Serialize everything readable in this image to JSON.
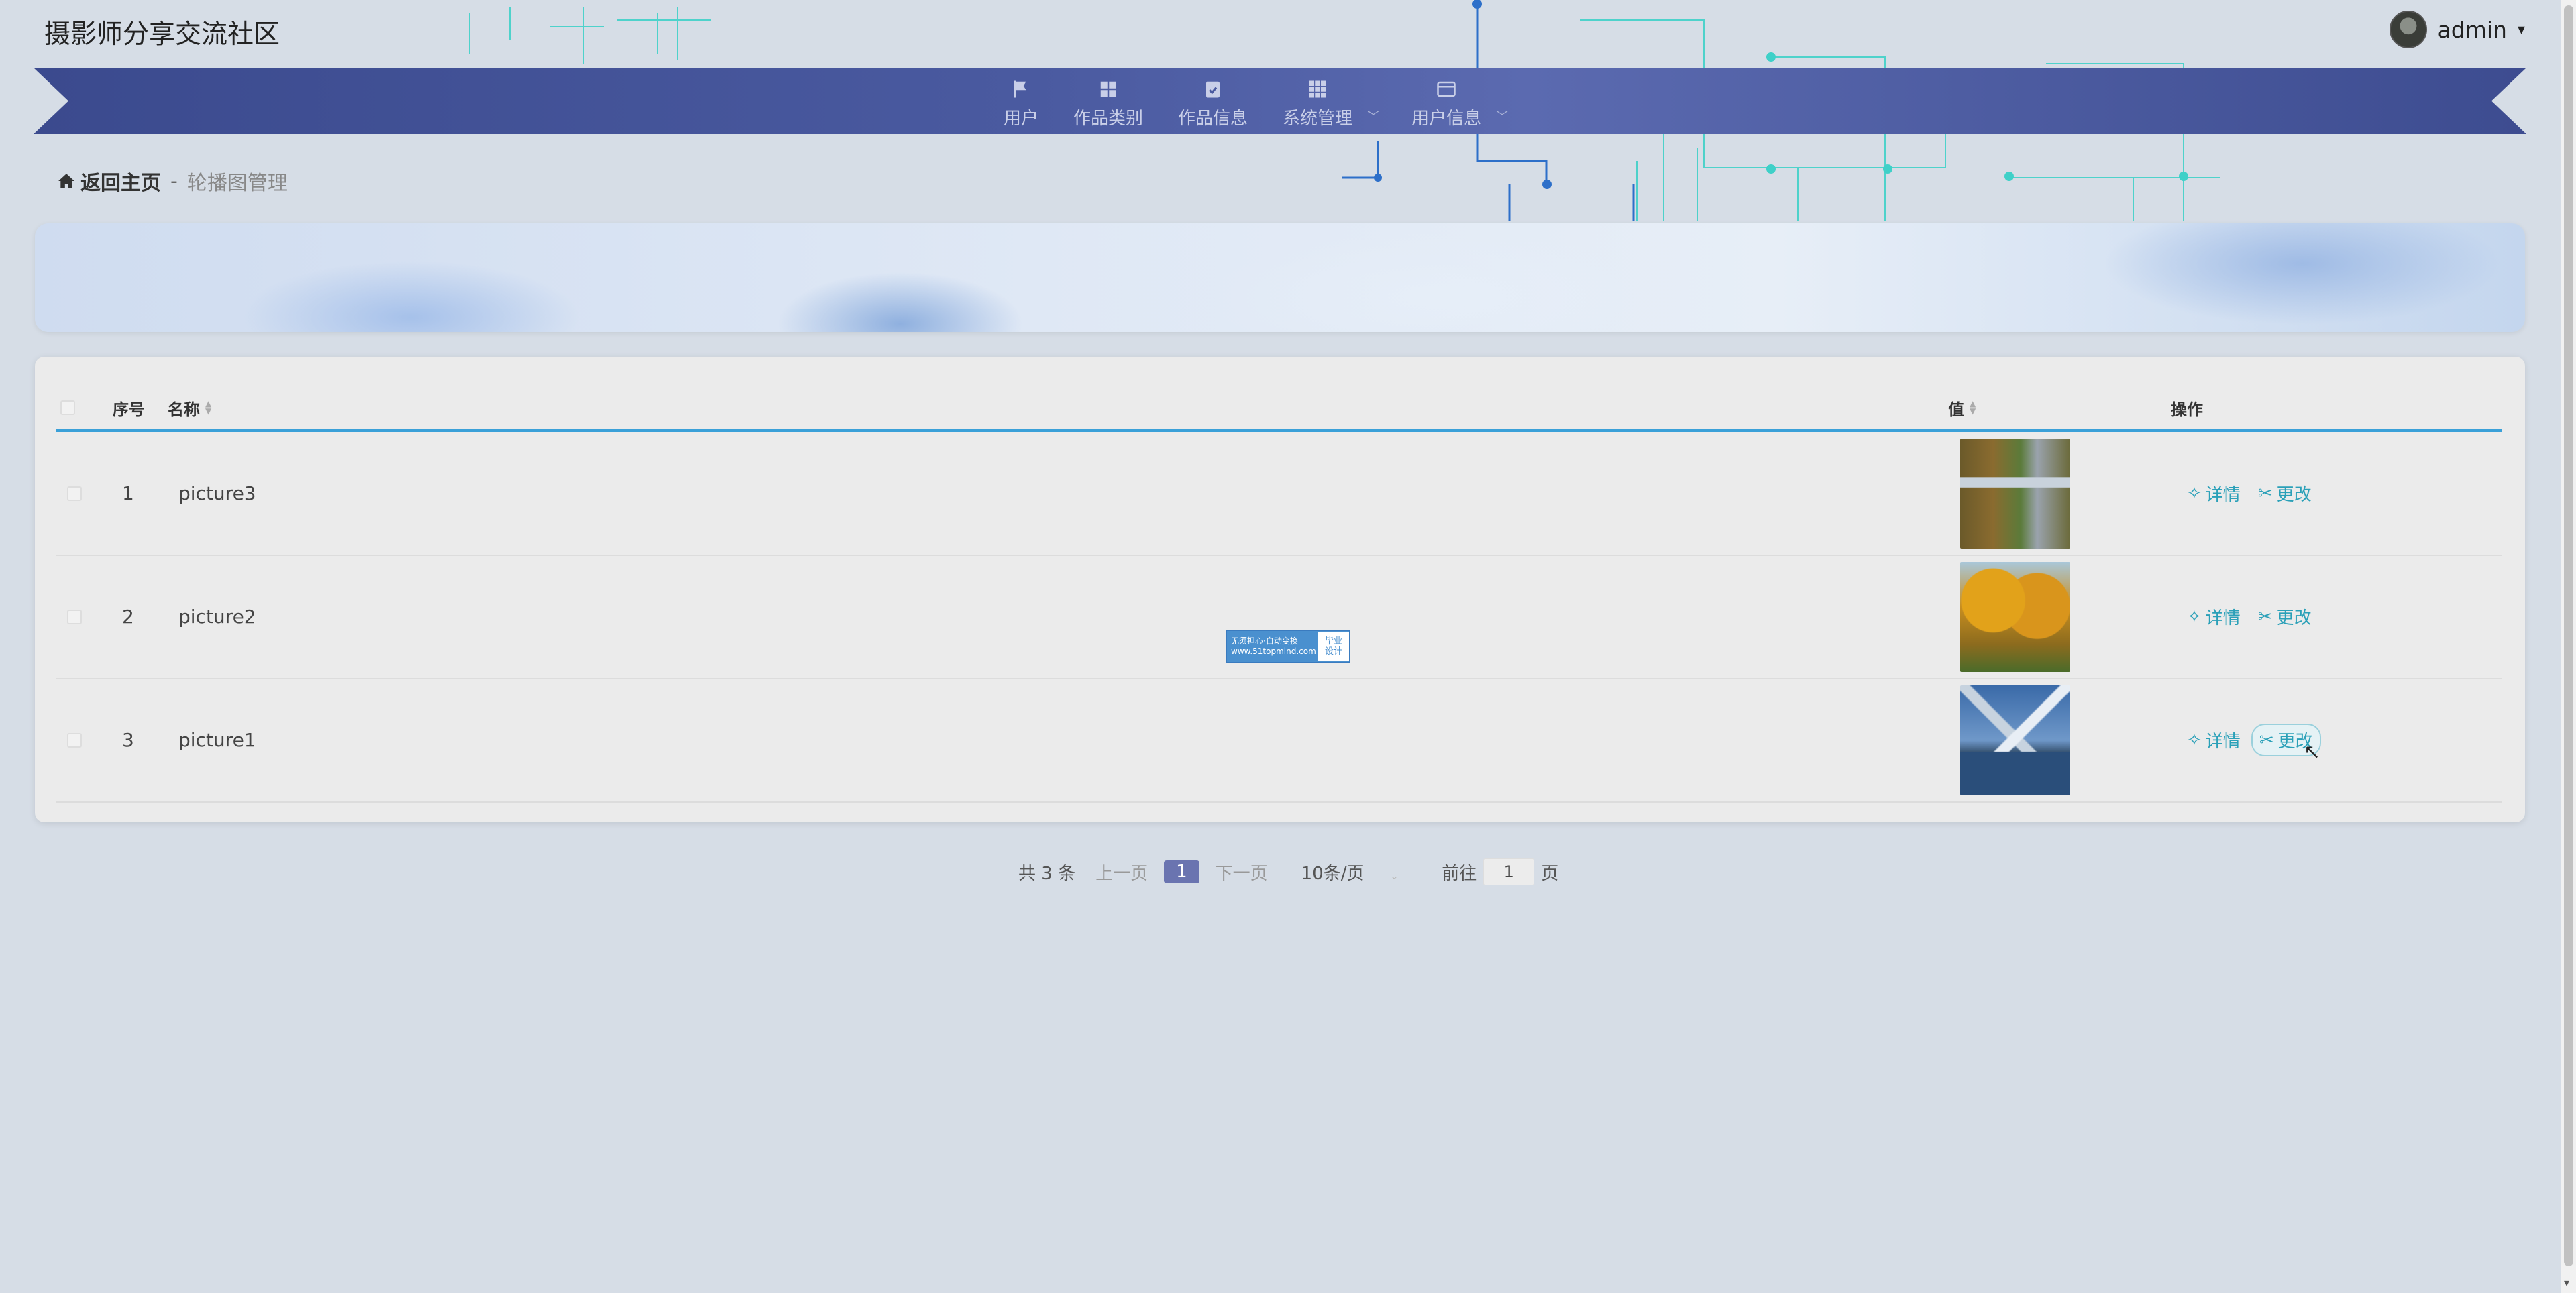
{
  "site": {
    "title": "摄影师分享交流社区"
  },
  "user": {
    "name": "admin",
    "caret": "▾"
  },
  "nav": {
    "items": [
      {
        "label": "用户",
        "icon": "flag-icon"
      },
      {
        "label": "作品类别",
        "icon": "grid-icon"
      },
      {
        "label": "作品信息",
        "icon": "clipboard-check-icon"
      },
      {
        "label": "系统管理",
        "icon": "apps-grid-icon",
        "dropdown": "﹀"
      },
      {
        "label": "用户信息",
        "icon": "card-icon",
        "dropdown": "﹀"
      }
    ]
  },
  "breadcrumb": {
    "home": "返回主页",
    "sep": "-",
    "current": "轮播图管理"
  },
  "table": {
    "headers": {
      "index": "序号",
      "name": "名称",
      "value": "值",
      "ops": "操作"
    },
    "rows": [
      {
        "index": "1",
        "name": "picture3",
        "thumb": "lake-cliff-photo"
      },
      {
        "index": "2",
        "name": "picture2",
        "thumb": "autumn-trees-photo"
      },
      {
        "index": "3",
        "name": "picture1",
        "thumb": "mountain-lake-photo"
      }
    ],
    "actions": {
      "detail": "详情",
      "edit": "更改"
    }
  },
  "pager": {
    "total": "共 3 条",
    "prev": "上一页",
    "current": "1",
    "next": "下一页",
    "size": "10条/页",
    "goto": "前往",
    "goto_value": "1",
    "page_unit": "页"
  },
  "watermark": {
    "line1": "无须担心·自动变换",
    "line2": "www.51topmind.com",
    "badge1": "毕业",
    "badge2": "设计"
  },
  "colors": {
    "accent": "#2aa0b8",
    "nav_bg": "#4a5aa0",
    "header_line": "#3aa0d8",
    "page_active": "#6a74b0"
  }
}
